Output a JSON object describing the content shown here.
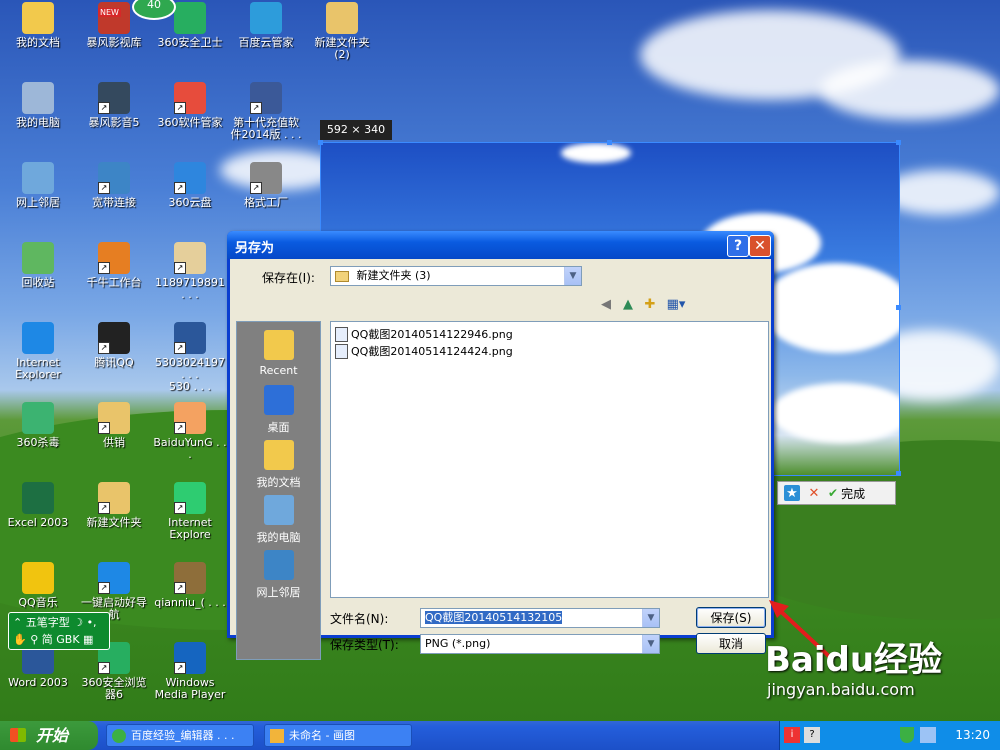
{
  "desktop": {
    "icons": [
      {
        "label": "我的文档",
        "color": "#f2c94c"
      },
      {
        "label": "暴风影视库",
        "color": "#c0392b"
      },
      {
        "label": "360安全卫士",
        "color": "#27ae60"
      },
      {
        "label": "百度云管家",
        "color": "#2d9cdb"
      },
      {
        "label": "新建文件夹\n(2)",
        "color": "#e9c46a"
      },
      {
        "label": "我的电脑",
        "color": "#9db7d8"
      },
      {
        "label": "暴风影音5",
        "color": "#34495e"
      },
      {
        "label": "360软件管家",
        "color": "#e74c3c"
      },
      {
        "label": "第十代充值软\n件2014版 . . .",
        "color": "#3b5998"
      },
      {
        "label": "网上邻居",
        "color": "#6fa8dc"
      },
      {
        "label": "宽带连接",
        "color": "#3d85c6"
      },
      {
        "label": "360云盘",
        "color": "#2e86de"
      },
      {
        "label": "格式工厂",
        "color": "#888888"
      },
      {
        "label": "回收站",
        "color": "#5fb760"
      },
      {
        "label": "千牛工作台",
        "color": "#e67e22"
      },
      {
        "label": "1189719891 . . .",
        "color": "#e5cf9b"
      },
      {
        "label": "Internet\nExplorer",
        "color": "#1e88e5"
      },
      {
        "label": "腾讯QQ",
        "color": "#222222"
      },
      {
        "label": "5303024197 . . .\n530 . . .",
        "color": "#2b579a"
      },
      {
        "label": "360杀毒",
        "color": "#3cb371"
      },
      {
        "label": "供销",
        "color": "#e9c46a"
      },
      {
        "label": "BaiduYunG . . .",
        "color": "#f4a261"
      },
      {
        "label": "Excel 2003",
        "color": "#1d6f42"
      },
      {
        "label": "新建文件夹",
        "color": "#e9c46a"
      },
      {
        "label": "Internet\nExplore",
        "color": "#2ecc71"
      },
      {
        "label": "QQ音乐",
        "color": "#f1c40f"
      },
      {
        "label": "一键启动好导\n航",
        "color": "#1e88e5"
      },
      {
        "label": "qianniu_( . . .",
        "color": "#8e6e3a"
      },
      {
        "label": "Word 2003",
        "color": "#2b579a"
      },
      {
        "label": "360安全浏览\n器6",
        "color": "#27ae60"
      },
      {
        "label": "Windows\nMedia Player",
        "color": "#1565c0"
      }
    ],
    "badge_count": "40",
    "new_badge": "NEW"
  },
  "capture": {
    "size_label": "592 × 340",
    "done_label": "完成"
  },
  "dialog": {
    "title": "另存为",
    "help_btn": "?",
    "close_btn": "✕",
    "save_in_label": "保存在(I):",
    "save_in_value": "新建文件夹 (3)",
    "places": [
      "Recent",
      "桌面",
      "我的文档",
      "我的电脑",
      "网上邻居"
    ],
    "files": [
      "QQ截图20140514122946.png",
      "QQ截图20140514124424.png"
    ],
    "filename_label": "文件名(N):",
    "filename_value": "QQ截图20140514132105",
    "filetype_label": "保存类型(T):",
    "filetype_value": "PNG (*.png)",
    "save_button": "保存(S)",
    "cancel_button": "取消"
  },
  "ime": {
    "mode": "五笔字型",
    "charset": "简 GBK"
  },
  "taskbar": {
    "start_label": "开始",
    "tasks": [
      "百度经验_编辑器 . . .",
      "未命名 - 画图"
    ],
    "clock": "13:20"
  },
  "watermark": {
    "brand": "Baidu经验",
    "url": "jingyan.baidu.com"
  }
}
